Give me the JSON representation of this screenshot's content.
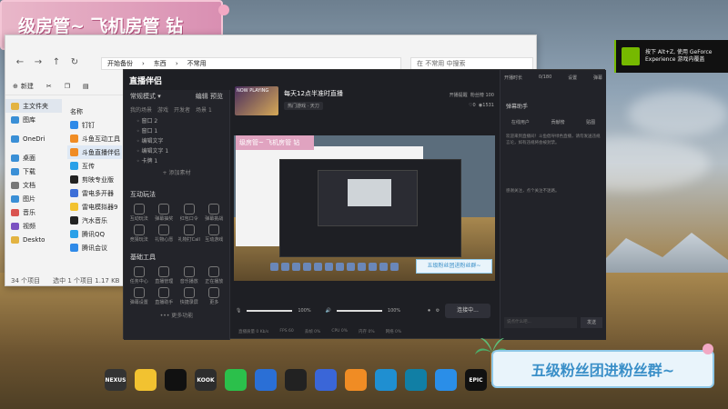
{
  "banners": {
    "top_text": "级房管~   飞机房管 钻",
    "bottom_text": "五级粉丝团进粉丝群~"
  },
  "explorer": {
    "breadcrumb": [
      "开始备份",
      "东西",
      "不常用"
    ],
    "search_placeholder": "在 不常用 中搜索",
    "new_label": "新建",
    "nav": [
      {
        "label": "主文件夹",
        "color": "#e3b341",
        "selected": true
      },
      {
        "label": "图库",
        "color": "#3a8fd6"
      },
      {
        "label": "OneDri",
        "color": "#3a8fd6"
      },
      {
        "label": "桌面",
        "color": "#3a8fd6"
      },
      {
        "label": "下载",
        "color": "#3a8fd6"
      },
      {
        "label": "文档",
        "color": "#777"
      },
      {
        "label": "图片",
        "color": "#3a8fd6"
      },
      {
        "label": "音乐",
        "color": "#d9534f"
      },
      {
        "label": "视频",
        "color": "#7b52c1"
      },
      {
        "label": "Deskto",
        "color": "#e3b341"
      }
    ],
    "files": [
      {
        "label": "名称",
        "color": "transparent"
      },
      {
        "label": "钉钉",
        "color": "#2f8ae8"
      },
      {
        "label": "斗鱼互动工具",
        "color": "#f08c24"
      },
      {
        "label": "斗鱼直播伴侣",
        "color": "#f08c24",
        "selected": true
      },
      {
        "label": "互传",
        "color": "#2aa0e8"
      },
      {
        "label": "剪映专业版",
        "color": "#222"
      },
      {
        "label": "雷电多开器",
        "color": "#3d6fd8"
      },
      {
        "label": "雷电模拟器9",
        "color": "#f2c230"
      },
      {
        "label": "汽水音乐",
        "color": "#222"
      },
      {
        "label": "腾讯QQ",
        "color": "#2aa0e8"
      },
      {
        "label": "腾讯会议",
        "color": "#2f8ae8"
      }
    ],
    "status": [
      "34 个项目",
      "选中 1 个项目  1.17 KB"
    ]
  },
  "app": {
    "title": "直播伴侣",
    "mode_label": "常规模式 ▾",
    "mode_tabs": [
      "编辑",
      "预览"
    ],
    "scene_tabs": [
      "我的场景",
      "游戏",
      "开发者",
      "场景 1"
    ],
    "scenes": [
      "窗口 2",
      "窗口 1",
      "编辑文字",
      "编辑文字 1",
      "卡牌 1"
    ],
    "add_scene": "+ 添加素材",
    "interact_label": "互动玩法",
    "interact_tools": [
      "互动玩法",
      "弹幕抽奖",
      "红包口令",
      "弹幕挑战",
      "竞猜玩法",
      "礼物心愿",
      "礼物打Call",
      "互动游戏"
    ],
    "basic_label": "基础工具",
    "basic_tools": [
      "任务中心",
      "直播管理",
      "音乐播放",
      "正在播放",
      "弹幕设置",
      "直播助手",
      "快捷录屏",
      "更多"
    ],
    "more_functions": "••• 更多功能",
    "room": {
      "cover_text": "NOW PLAYING",
      "name": "每天12点半准时直播",
      "tag": "热门游戏 · 天刀",
      "actions": [
        "开播提醒",
        "粉丝榜 100"
      ],
      "stats": [
        "0",
        "1531"
      ]
    },
    "preview_banner": "级房管~ 飞机房管 钻",
    "preview_bottom_banner": "五级粉丝团进粉丝群~",
    "controls": {
      "mic_pct": "100%",
      "speaker_pct": "100%"
    },
    "live_button": "连接中...",
    "status_items": [
      "直播质量 0 Kb/s",
      "FPS 60",
      "丢帧 0%",
      "CPU 0%",
      "内存 0%",
      "网络 0%"
    ],
    "right_top": [
      "开播时长",
      "0/180",
      "设置",
      "弹幕"
    ],
    "danmu_title": "弹幕助手",
    "danmu_tabs": [
      "在线用户",
      "贡献榜",
      "贴图"
    ],
    "danmu_msgs": [
      "欢迎来到直播间！斗鱼倡导绿色直播，请勿发送违规言论，如有违规将会被封禁。",
      "感谢关注，点个关注不迷路。"
    ],
    "danmu_input_placeholder": "说点什么吧...",
    "danmu_send": "发送"
  },
  "toast": {
    "line1": "按下 Alt+Z, 使用 GeForce",
    "line2": "Experience 游戏内覆盖"
  },
  "taskbar": [
    {
      "name": "nexus",
      "label": "NEXUS",
      "color": "#333"
    },
    {
      "name": "explorer",
      "label": "",
      "color": "#f2c230"
    },
    {
      "name": "game-controller",
      "label": "",
      "color": "#111"
    },
    {
      "name": "kook",
      "label": "KOOK",
      "color": "#2d2d2d"
    },
    {
      "name": "wechat",
      "label": "",
      "color": "#2bc04b"
    },
    {
      "name": "bot",
      "label": "",
      "color": "#2a6fd6"
    },
    {
      "name": "qq",
      "label": "",
      "color": "#222"
    },
    {
      "name": "capture",
      "label": "",
      "color": "#3a66d8"
    },
    {
      "name": "douyu",
      "label": "",
      "color": "#f08c24"
    },
    {
      "name": "edge",
      "label": "",
      "color": "#1f8fd1"
    },
    {
      "name": "steam-like",
      "label": "",
      "color": "#117fa5"
    },
    {
      "name": "windows",
      "label": "",
      "color": "#2a8ee8"
    },
    {
      "name": "epic",
      "label": "EPIC",
      "color": "#111"
    }
  ]
}
